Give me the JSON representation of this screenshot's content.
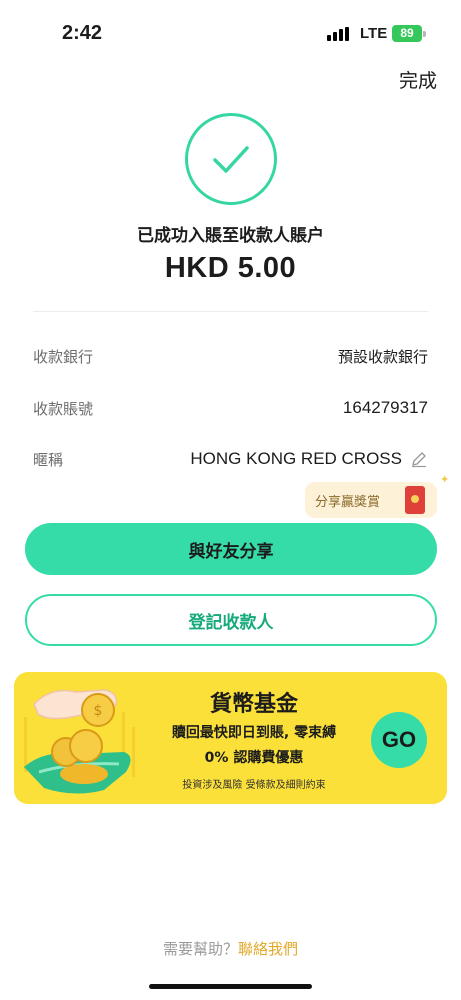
{
  "status_bar": {
    "time": "2:42",
    "network": "LTE",
    "battery": "89"
  },
  "header": {
    "done_label": "完成"
  },
  "result": {
    "icon": "checkmark-icon",
    "message": "已成功入賬至收款人賬户",
    "amount": "HKD 5.00"
  },
  "details": [
    {
      "label": "收款銀行",
      "value": "預設收款銀行"
    },
    {
      "label": "收款賬號",
      "value": "164279317"
    },
    {
      "label": "暱稱",
      "value": "HONG KONG RED CROSS"
    }
  ],
  "reward_bubble": {
    "label": "分享贏獎賞"
  },
  "actions": {
    "share_label": "與好友分享",
    "register_label": "登記收款人"
  },
  "banner": {
    "title": "貨幣基金",
    "line1": "贖回最快即日到賬, 零束縛",
    "line2": "0% 認購費優惠",
    "note": "投資涉及風險 受條款及細則約束",
    "go_label": "GO"
  },
  "footer": {
    "help_text": "需要幫助？",
    "contact_label": "聯絡我們"
  },
  "colors": {
    "accent": "#36dca8",
    "banner": "#fbe03a",
    "link": "#e2a92a"
  }
}
